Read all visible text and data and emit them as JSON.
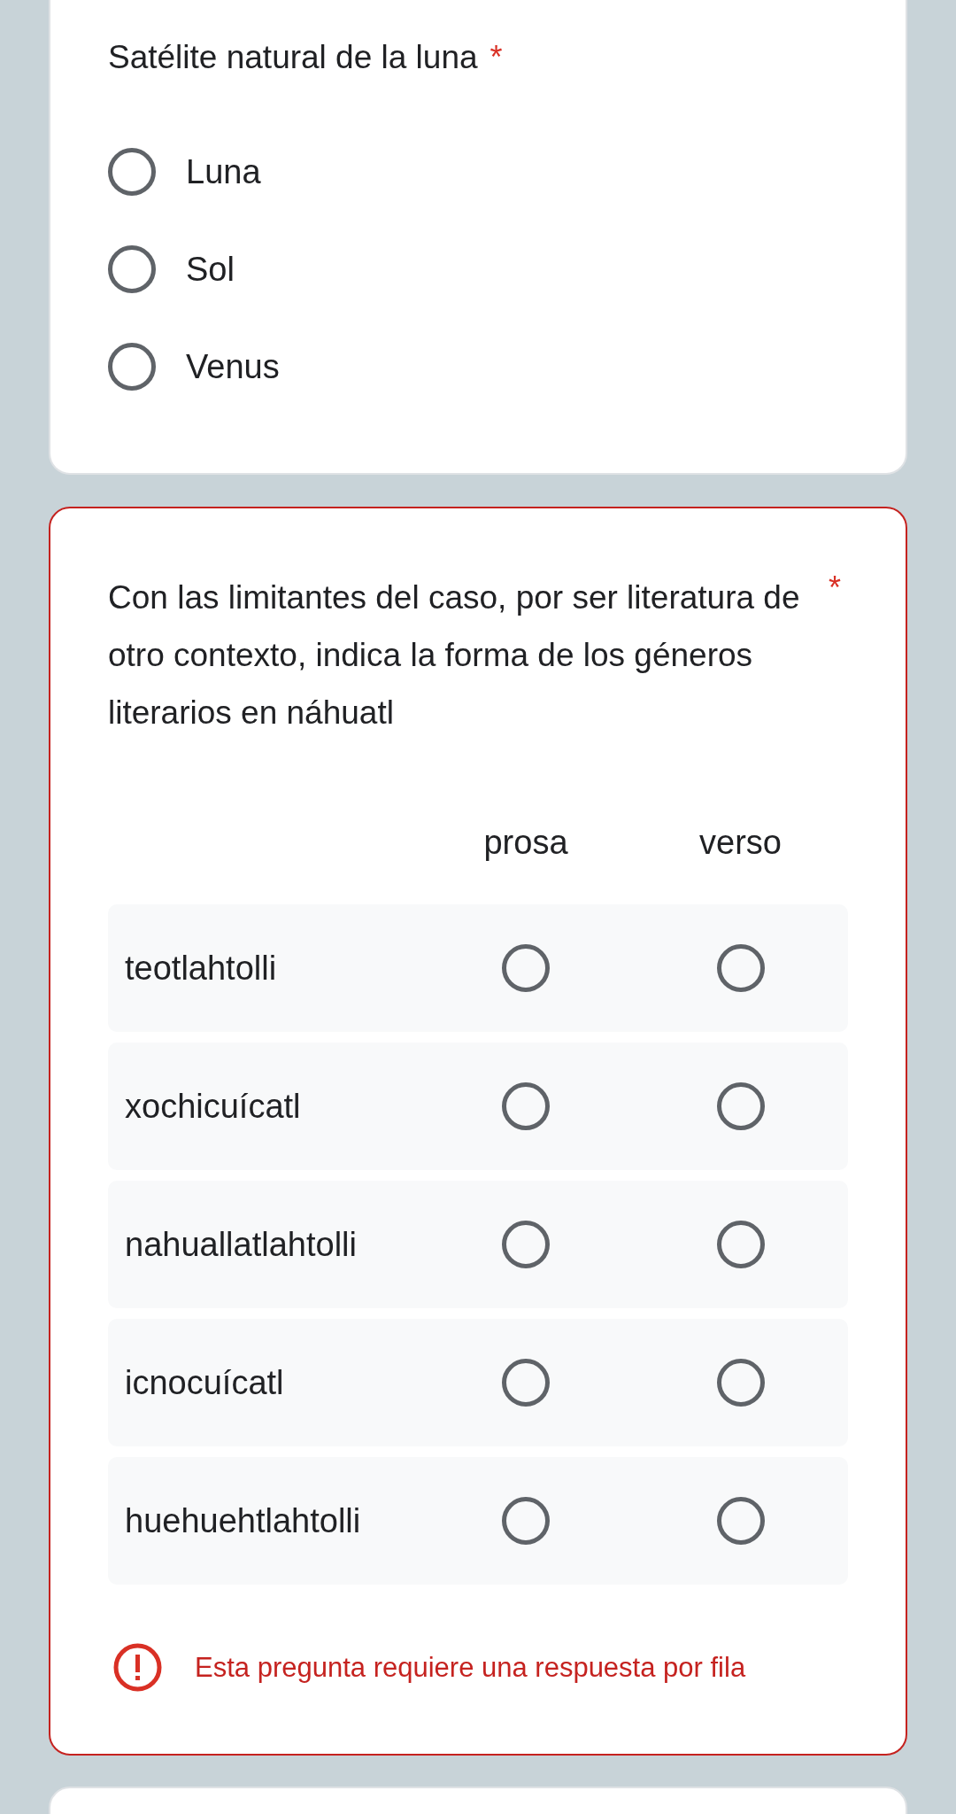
{
  "questions": [
    {
      "kind": "multiple_choice",
      "title": "Satélite natural de la luna",
      "required_mark": "*",
      "options": [
        {
          "label": "Luna",
          "selected": false
        },
        {
          "label": "Sol",
          "selected": false
        },
        {
          "label": "Venus",
          "selected": false
        }
      ]
    },
    {
      "kind": "grid",
      "title": "Con las limitantes del caso, por ser literatura de otro contexto, indica la forma de los géneros literarios en náhuatl",
      "required_mark": "*",
      "columns": [
        "prosa",
        "verso"
      ],
      "rows": [
        {
          "label": "teotlahtolli",
          "cells": [
            {
              "selected": false
            },
            {
              "selected": false
            }
          ]
        },
        {
          "label": "xochicuícatl",
          "cells": [
            {
              "selected": false
            },
            {
              "selected": false
            }
          ]
        },
        {
          "label": "nahuallatlahtolli",
          "cells": [
            {
              "selected": false
            },
            {
              "selected": false
            }
          ]
        },
        {
          "label": "icnocuícatl",
          "cells": [
            {
              "selected": false
            },
            {
              "selected": false
            }
          ]
        },
        {
          "label": "huehuehtlahtolli",
          "cells": [
            {
              "selected": false
            },
            {
              "selected": false
            }
          ]
        }
      ],
      "error": "Esta pregunta requiere una respuesta por fila"
    }
  ]
}
